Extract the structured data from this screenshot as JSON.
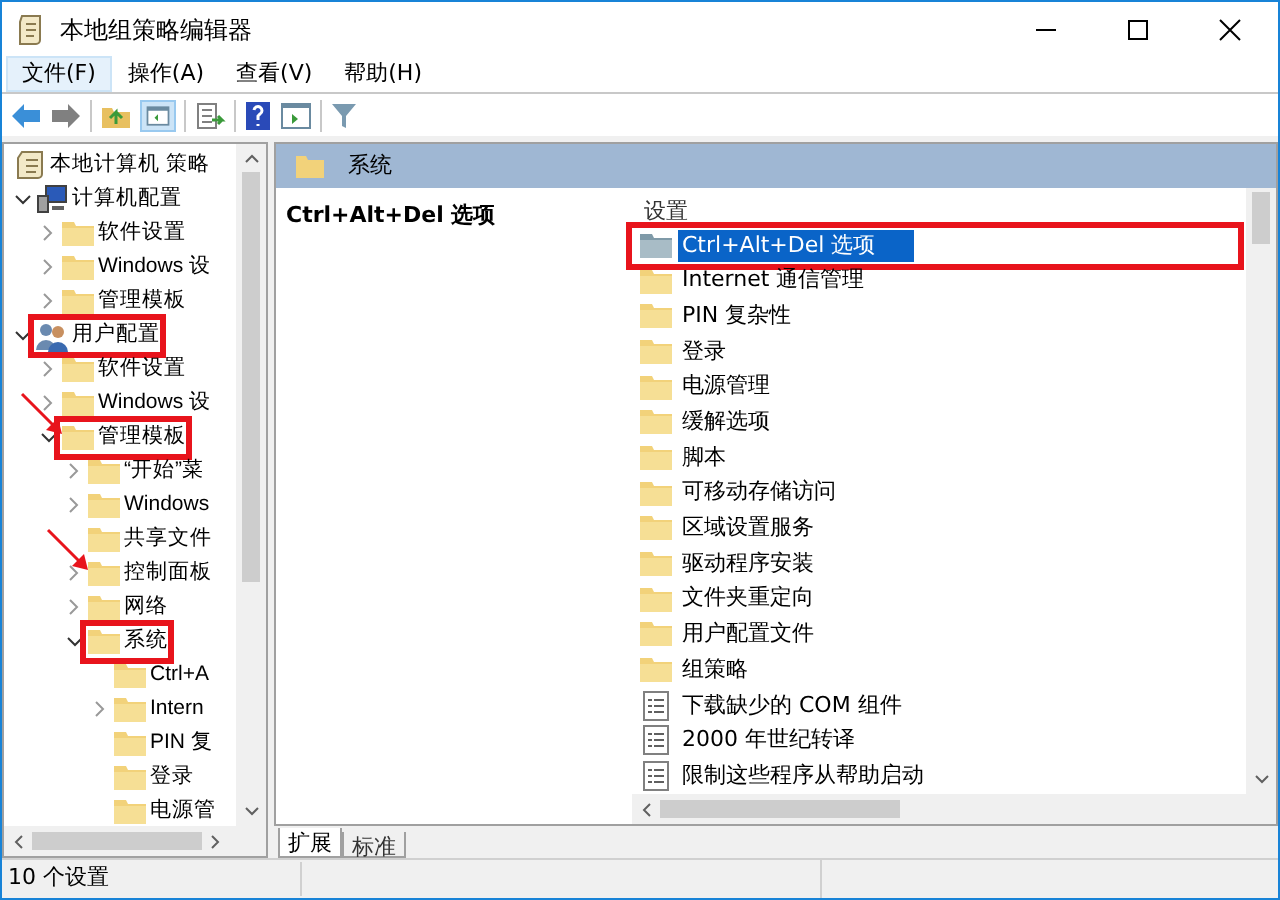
{
  "window": {
    "title": "本地组策略编辑器"
  },
  "menu": [
    {
      "label": "文件(F)",
      "selected": true
    },
    {
      "label": "操作(A)",
      "selected": false
    },
    {
      "label": "查看(V)",
      "selected": false
    },
    {
      "label": "帮助(H)",
      "selected": false
    }
  ],
  "tree": [
    {
      "label": "本地计算机 策略",
      "kind": "policy",
      "children": [
        {
          "label": "计算机配置",
          "kind": "computer",
          "expanded": true,
          "children": [
            {
              "label": "软件设置",
              "kind": "folder",
              "expanded": false
            },
            {
              "label": "Windows 设",
              "kind": "folder",
              "expanded": false
            },
            {
              "label": "管理模板",
              "kind": "folder",
              "expanded": false
            }
          ]
        },
        {
          "label": "用户配置",
          "kind": "user",
          "expanded": true,
          "highlighted": true,
          "children": [
            {
              "label": "软件设置",
              "kind": "folder",
              "expanded": false
            },
            {
              "label": "Windows 设",
              "kind": "folder",
              "expanded": false
            },
            {
              "label": "管理模板",
              "kind": "folder",
              "expanded": true,
              "highlighted": true,
              "arrow": true,
              "children": [
                {
                  "label": "“开始”菜",
                  "kind": "folder",
                  "expanded": false
                },
                {
                  "label": "Windows",
                  "kind": "folder",
                  "expanded": false
                },
                {
                  "label": "共享文件",
                  "kind": "folder"
                },
                {
                  "label": "控制面板",
                  "kind": "folder",
                  "expanded": false,
                  "arrow": true
                },
                {
                  "label": "网络",
                  "kind": "folder",
                  "expanded": false
                },
                {
                  "label": "系统",
                  "kind": "folder",
                  "expanded": true,
                  "highlighted": true,
                  "children": [
                    {
                      "label": "Ctrl+A",
                      "kind": "folder"
                    },
                    {
                      "label": "Intern",
                      "kind": "folder",
                      "expanded": false
                    },
                    {
                      "label": "PIN 复",
                      "kind": "folder"
                    },
                    {
                      "label": "登录",
                      "kind": "folder"
                    },
                    {
                      "label": "电源管",
                      "kind": "folder"
                    }
                  ]
                }
              ]
            }
          ]
        }
      ]
    }
  ],
  "details": {
    "header": "系统",
    "description_title": "Ctrl+Alt+Del 选项",
    "column_header": "设置",
    "items": [
      {
        "label": "Ctrl+Alt+Del 选项",
        "kind": "folder",
        "selected": true,
        "highlighted": true
      },
      {
        "label": "Internet 通信管理",
        "kind": "folder",
        "selected": false
      },
      {
        "label": "PIN 复杂性",
        "kind": "folder",
        "selected": false
      },
      {
        "label": "登录",
        "kind": "folder",
        "selected": false
      },
      {
        "label": "电源管理",
        "kind": "folder",
        "selected": false
      },
      {
        "label": "缓解选项",
        "kind": "folder",
        "selected": false
      },
      {
        "label": "脚本",
        "kind": "folder",
        "selected": false
      },
      {
        "label": "可移动存储访问",
        "kind": "folder",
        "selected": false
      },
      {
        "label": "区域设置服务",
        "kind": "folder",
        "selected": false
      },
      {
        "label": "驱动程序安装",
        "kind": "folder",
        "selected": false
      },
      {
        "label": "文件夹重定向",
        "kind": "folder",
        "selected": false
      },
      {
        "label": "用户配置文件",
        "kind": "folder",
        "selected": false
      },
      {
        "label": "组策略",
        "kind": "folder",
        "selected": false
      },
      {
        "label": "下载缺少的 COM 组件",
        "kind": "setting",
        "selected": false
      },
      {
        "label": "2000 年世纪转译",
        "kind": "setting",
        "selected": false
      },
      {
        "label": "限制这些程序从帮助启动",
        "kind": "setting",
        "selected": false
      }
    ]
  },
  "tabs": [
    {
      "label": "扩展",
      "selected": true
    },
    {
      "label": "标准",
      "selected": false
    }
  ],
  "status_bar": "10 个设置"
}
